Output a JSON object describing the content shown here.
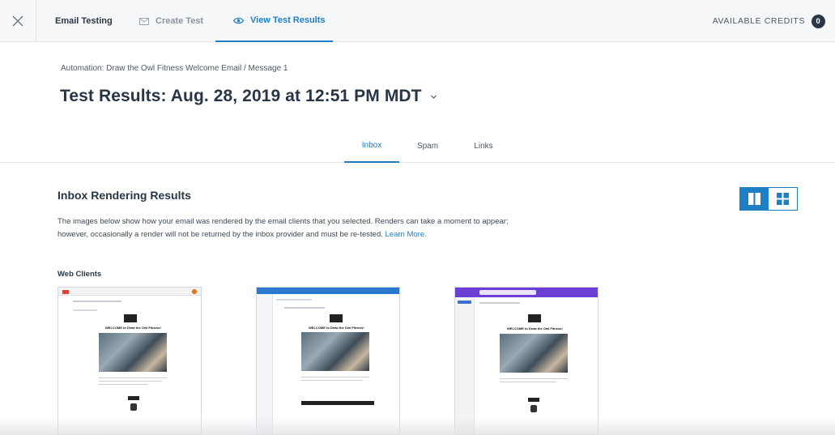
{
  "nav": {
    "brand": "Email Testing",
    "create_test": "Create Test",
    "view_results": "View Test Results",
    "credits_label": "AVAILABLE CREDITS",
    "credits_count": "0"
  },
  "header": {
    "breadcrumb": "Automation: Draw the Owl Fitness Welcome Email / Message 1",
    "title": "Test Results: Aug. 28, 2019 at 12:51 PM MDT"
  },
  "tabs": [
    "Inbox",
    "Spam",
    "Links"
  ],
  "content": {
    "section_title": "Inbox Rendering Results",
    "description_line1": "The images below show how your email was rendered by the email clients that you selected. Renders can take a moment to appear;",
    "description_line2": "however, occasionally a render will not be returned by the inbox provider and must be re-tested.",
    "learn_more": "Learn More.",
    "group_title": "Web Clients"
  },
  "email_preview": {
    "headline": "WELCOME to Draw the Owl Fitness!"
  },
  "colors": {
    "accent": "#1e7fc4",
    "outlook_header": "#2b78d0",
    "yahoo_header": "#6b3fd6",
    "gmail_red": "#e34133"
  },
  "icons": {
    "close": "close-icon",
    "create": "envelope-icon",
    "view": "eye-icon",
    "chevron": "chevron-down-icon",
    "two_col": "two-column-view-icon",
    "grid": "grid-view-icon"
  }
}
